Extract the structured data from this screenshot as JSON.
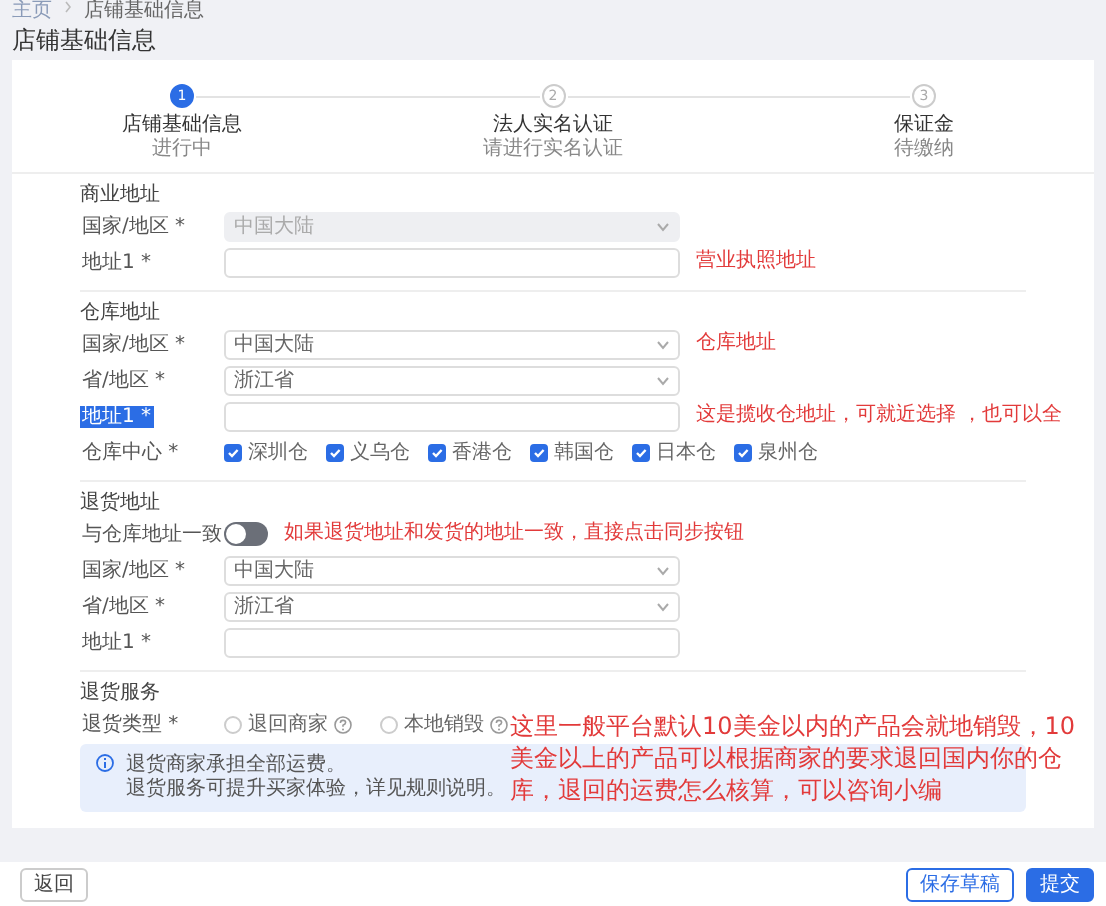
{
  "breadcrumb": [
    {
      "label": "主页"
    },
    {
      "label": "店铺基础信息"
    }
  ],
  "page_title": "店铺基础信息",
  "steps": [
    {
      "number": "1",
      "title": "店铺基础信息",
      "subtitle": "进行中",
      "selected": true
    },
    {
      "number": "2",
      "title": "法人实名认证",
      "subtitle": "请进行实名认证",
      "selected": false
    },
    {
      "number": "3",
      "title": "保证金",
      "subtitle": "待缴纳",
      "selected": false
    }
  ],
  "sections": [
    {
      "title": "商业地址",
      "rows": [
        {
          "kind": "select",
          "label": "国家/地区 *",
          "value": "中国大陆",
          "disabled": true,
          "highlighted": false
        },
        {
          "kind": "input",
          "label": "地址1 *",
          "disabled": false,
          "highlighted": false,
          "note": "营业执照地址"
        }
      ]
    },
    {
      "title": "仓库地址",
      "rows": [
        {
          "kind": "select",
          "label": "国家/地区 *",
          "value": "中国大陆",
          "disabled": false,
          "highlighted": false,
          "note": "仓库地址"
        },
        {
          "kind": "select",
          "label": "省/地区 *",
          "value": "浙江省",
          "disabled": false,
          "highlighted": false
        },
        {
          "kind": "input",
          "label": "地址1 *",
          "disabled": false,
          "highlighted": true,
          "note": "这是揽收仓地址，可就近选择 ，也可以全"
        },
        {
          "kind": "checkboxes",
          "label": "仓库中心 *",
          "highlighted": false,
          "options": [
            {
              "label": "深圳仓",
              "checked": true
            },
            {
              "label": "义乌仓",
              "checked": true
            },
            {
              "label": "香港仓",
              "checked": true
            },
            {
              "label": "韩国仓",
              "checked": true
            },
            {
              "label": "日本仓",
              "checked": true
            },
            {
              "label": "泉州仓",
              "checked": true
            }
          ]
        }
      ]
    },
    {
      "title": "退货地址",
      "rows": [
        {
          "kind": "toggle",
          "label": "与仓库地址一致",
          "on": false,
          "highlighted": false,
          "note": "如果退货地址和发货的地址一致，直接点击同步按钮"
        },
        {
          "kind": "select",
          "label": "国家/地区 *",
          "value": "中国大陆",
          "disabled": false,
          "highlighted": false
        },
        {
          "kind": "select",
          "label": "省/地区 *",
          "value": "浙江省",
          "disabled": false,
          "highlighted": false
        },
        {
          "kind": "input",
          "label": "地址1 *",
          "disabled": false,
          "highlighted": false
        }
      ]
    },
    {
      "title": "退货服务",
      "rows": [
        {
          "kind": "radios",
          "label": "退货类型 *",
          "highlighted": false,
          "options": [
            {
              "label": "退回商家",
              "selected": false
            },
            {
              "label": "本地销毁",
              "selected": false
            }
          ],
          "note": "这里一般平台默认10美金以内的产品会就地销毁，10美金以上的产品可以根据商家的要求退回国内你的仓库，退回的运费怎么核算，可以咨询小编"
        }
      ],
      "info": [
        "退货商家承担全部运费。",
        "退货服务可提升买家体验，详见规则说明。"
      ]
    }
  ],
  "footer": {
    "back": "返回",
    "draft": "保存草稿",
    "submit": "提交"
  }
}
